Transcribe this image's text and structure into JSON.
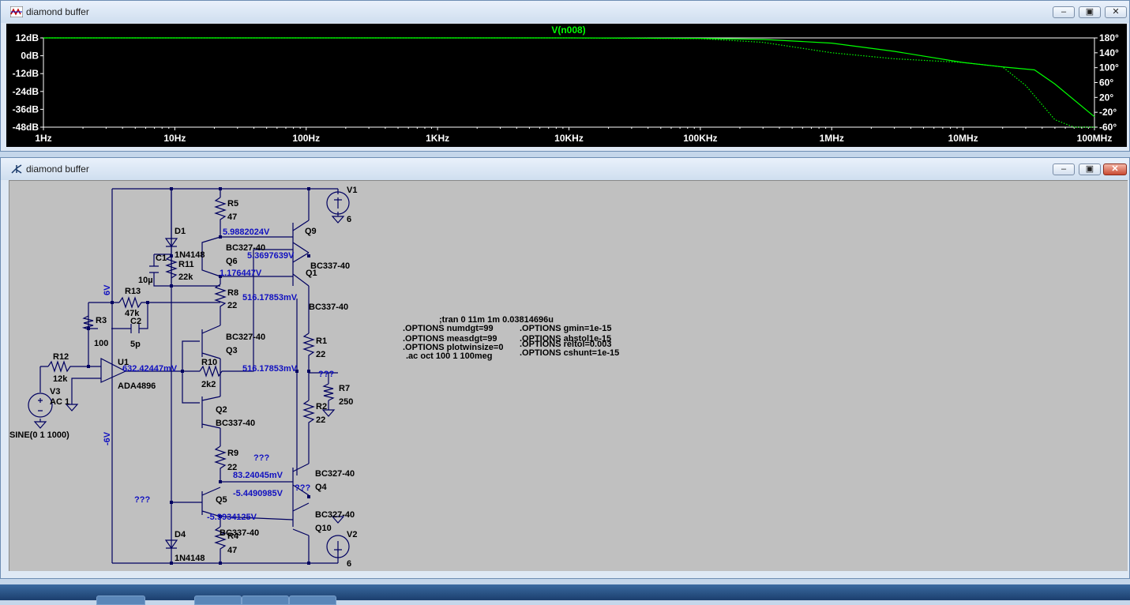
{
  "plot_window": {
    "title": "diamond buffer",
    "trace_label": "V(n008)",
    "y_left_ticks": [
      "12dB",
      "0dB",
      "-12dB",
      "-24dB",
      "-36dB",
      "-48dB"
    ],
    "y_right_ticks": [
      "180°",
      "140°",
      "100°",
      "60°",
      "20°",
      "-20°",
      "-60°"
    ],
    "x_ticks": [
      "1Hz",
      "10Hz",
      "100Hz",
      "1KHz",
      "10KHz",
      "100KHz",
      "1MHz",
      "10MHz",
      "100MHz"
    ],
    "trace_color": "#00ff00"
  },
  "schematic_window": {
    "title": "diamond buffer",
    "components": {
      "r5": "R5",
      "r5v": "47",
      "d1": "D1",
      "d1v": "1N4148",
      "c1": "C1",
      "c1v": "10µ",
      "r11": "R11",
      "r11v": "22k",
      "q9": "Q9",
      "q6": "Q6",
      "q6v": "BC327-40",
      "q1": "Q1",
      "q1v": "BC337-40",
      "q9v": "BC337-40",
      "r8": "R8",
      "r8v": "22",
      "r13": "R13",
      "r13v": "47k",
      "c2": "C2",
      "c2v": "5p",
      "r3": "R3",
      "r3v": "100",
      "q3": "Q3",
      "q3v": "BC327-40",
      "r1": "R1",
      "r1v": "22",
      "r12": "R12",
      "r12v": "12k",
      "u1": "U1",
      "u1v": "ADA4896",
      "r10": "R10",
      "r10v": "2k2",
      "r7": "R7",
      "r7v": "250",
      "v3": "V3",
      "v3ac": "AC 1",
      "v3sine": "SINE(0 1 1000)",
      "q2": "Q2",
      "q2v": "BC337-40",
      "r2": "R2",
      "r2v": "22",
      "r9": "R9",
      "r9v": "22",
      "q4": "Q4",
      "q4v": "BC327-40",
      "q5": "Q5",
      "q10": "Q10",
      "q10v": "BC327-40",
      "q5v": "BC337-40",
      "r4": "R4",
      "r4v": "47",
      "d4": "D4",
      "d4v": "1N4148",
      "v1": "V1",
      "v1v": "6",
      "v2": "V2",
      "v2v": "6",
      "plus6": "6V",
      "minus6": "-6V"
    },
    "voltages": {
      "n1": "5.9882024V",
      "n2": "5.3697639V",
      "n3": "1.176447V",
      "n4": "516.17853mV",
      "n5": "632.42447mV",
      "n6": "516.17853mV",
      "n7": "83.24045mV",
      "n8": "-5.4490985V",
      "n9": "-5.9934125V",
      "q1": "???",
      "q2": "???",
      "q3": "???",
      "q4": "???"
    },
    "directives": {
      "tran": ";tran 0 11m 1m 0.03814696u",
      "numdgt": ".OPTIONS numdgt=99",
      "measdgt": ".OPTIONS measdgt=99",
      "plotwinsize": ".OPTIONS plotwinsize=0",
      "ac": ".ac oct 100 1 100meg",
      "gmin": ".OPTIONS gmin=1e-15",
      "abstol": ".OPTIONS abstol1e-15",
      "reltol": ".OPTIONS reltol=0.003",
      "cshunt": ".OPTIONS cshunt=1e-15"
    }
  },
  "chart_data": {
    "type": "line",
    "title": "V(n008)",
    "x_scale": "log",
    "xlim": [
      1,
      100000000
    ],
    "ylim_left": [
      -48,
      12
    ],
    "ylim_right": [
      -60,
      180
    ],
    "series": [
      {
        "name": "V(n008)",
        "style": "solid",
        "x": [
          1,
          10,
          100,
          1000,
          10000,
          100000,
          300000,
          1000000,
          3000000,
          10000000,
          20000000,
          35000000,
          50000000,
          100000000
        ],
        "y": [
          12,
          12,
          12,
          12,
          12,
          11.7,
          11,
          8.5,
          3,
          -4.5,
          -7.5,
          -9.5,
          -19,
          -41
        ]
      },
      {
        "name": "",
        "style": "dotted",
        "x": [
          1,
          10,
          100,
          1000,
          10000,
          100000,
          300000,
          1000000,
          3000000,
          10000000,
          20000000,
          30000000,
          50000000,
          70000000,
          100000000
        ],
        "y": [
          12,
          12,
          12,
          12,
          12,
          11.5,
          9,
          2,
          -2,
          -4.5,
          -7.5,
          -20,
          -43,
          -48,
          -48
        ]
      }
    ]
  }
}
